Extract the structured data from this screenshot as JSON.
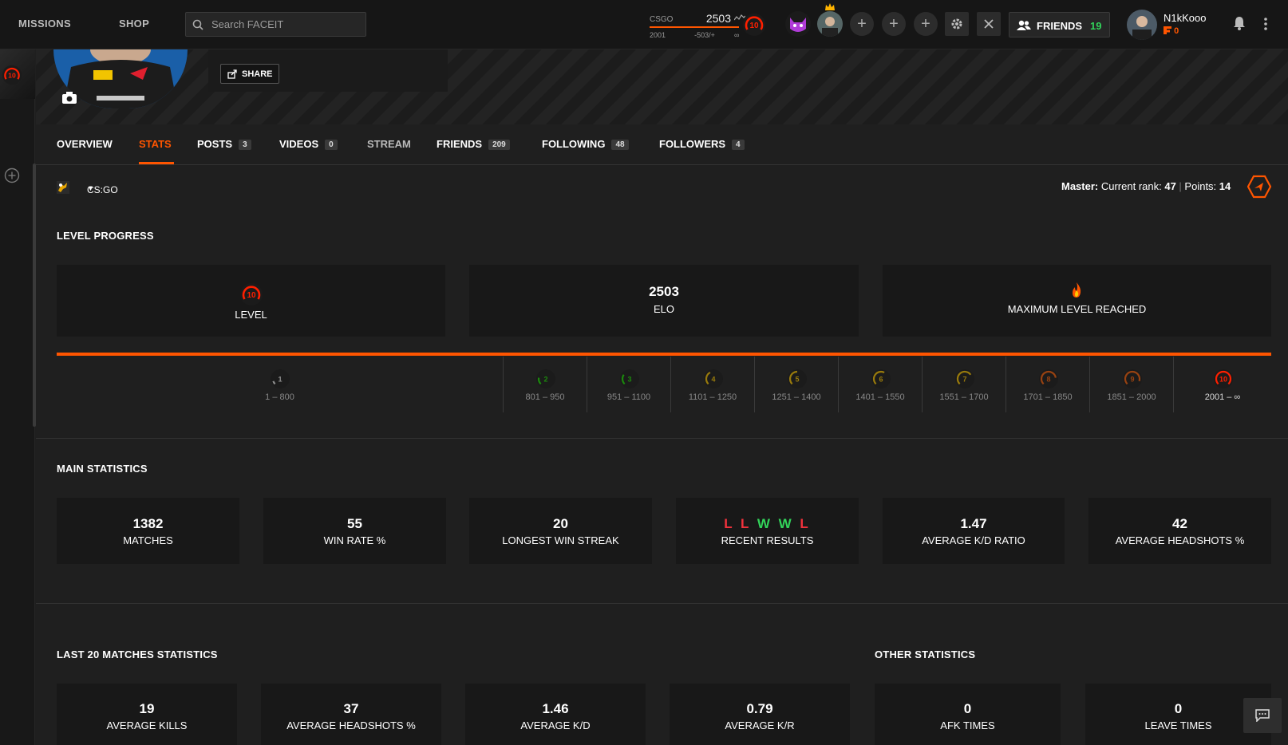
{
  "nav": {
    "missions": "MISSIONS",
    "shop": "SHOP"
  },
  "search": {
    "placeholder": "Search FACEIT"
  },
  "elo_widget": {
    "game": "CSGO",
    "elo": "2503",
    "min": "2001",
    "diff": "-503/+",
    "max": "∞",
    "level": "10"
  },
  "friends": {
    "label": "FRIENDS",
    "count": "19"
  },
  "user": {
    "name": "N1kKooo",
    "points": "0"
  },
  "rail": {
    "level": "10"
  },
  "profile": {
    "share_label": "SHARE"
  },
  "tabs": [
    {
      "label": "OVERVIEW",
      "count": ""
    },
    {
      "label": "STATS",
      "count": ""
    },
    {
      "label": "POSTS",
      "count": "3"
    },
    {
      "label": "VIDEOS",
      "count": "0"
    },
    {
      "label": "STREAM",
      "count": ""
    },
    {
      "label": "FRIENDS",
      "count": "209"
    },
    {
      "label": "FOLLOWING",
      "count": "48"
    },
    {
      "label": "FOLLOWERS",
      "count": "4"
    }
  ],
  "game_select": {
    "label": "CS:GO"
  },
  "rank": {
    "prefix": "Master:",
    "current_label": " Current rank: ",
    "current": "47",
    "points_label": "Points: ",
    "points": "14"
  },
  "level_progress": {
    "title": "LEVEL PROGRESS",
    "level_label": "LEVEL",
    "level_value": "10",
    "elo_value": "2503",
    "elo_label": "ELO",
    "max_label": "MAXIMUM LEVEL REACHED",
    "levels": [
      {
        "level": "1",
        "range": "1 – 800",
        "color": "#eeeeee"
      },
      {
        "level": "2",
        "range": "801 – 950",
        "color": "#1ce400"
      },
      {
        "level": "3",
        "range": "951 – 1100",
        "color": "#1ce400"
      },
      {
        "level": "4",
        "range": "1101 – 1250",
        "color": "#ffc800"
      },
      {
        "level": "5",
        "range": "1251 – 1400",
        "color": "#ffc800"
      },
      {
        "level": "6",
        "range": "1401 – 1550",
        "color": "#ffc800"
      },
      {
        "level": "7",
        "range": "1551 – 1700",
        "color": "#ffc800"
      },
      {
        "level": "8",
        "range": "1701 – 1850",
        "color": "#ff6309"
      },
      {
        "level": "9",
        "range": "1851 – 2000",
        "color": "#ff6309"
      },
      {
        "level": "10",
        "range": "2001 – ∞",
        "color": "#fe1f00"
      }
    ]
  },
  "main_stats": {
    "title": "MAIN STATISTICS",
    "matches": {
      "value": "1382",
      "label": "MATCHES"
    },
    "win_rate": {
      "value": "55",
      "label": "WIN RATE %"
    },
    "win_streak": {
      "value": "20",
      "label": "LONGEST WIN STREAK"
    },
    "recent": {
      "results": [
        "L",
        "L",
        "W",
        "W",
        "L"
      ],
      "label": "RECENT RESULTS"
    },
    "kd": {
      "value": "1.47",
      "label": "AVERAGE K/D RATIO"
    },
    "hs": {
      "value": "42",
      "label": "AVERAGE HEADSHOTS %"
    }
  },
  "last20": {
    "title": "LAST 20 MATCHES STATISTICS",
    "kills": {
      "value": "19",
      "label": "AVERAGE KILLS"
    },
    "hs": {
      "value": "37",
      "label": "AVERAGE HEADSHOTS %"
    },
    "kd": {
      "value": "1.46",
      "label": "AVERAGE K/D"
    },
    "kr": {
      "value": "0.79",
      "label": "AVERAGE K/R"
    }
  },
  "other": {
    "title": "OTHER STATISTICS",
    "afk": {
      "value": "0",
      "label": "AFK TIMES"
    },
    "leave": {
      "value": "0",
      "label": "LEAVE TIMES"
    }
  },
  "colors": {
    "accent": "#ff5500",
    "win": "#32d35a",
    "loss": "#f0323c"
  }
}
